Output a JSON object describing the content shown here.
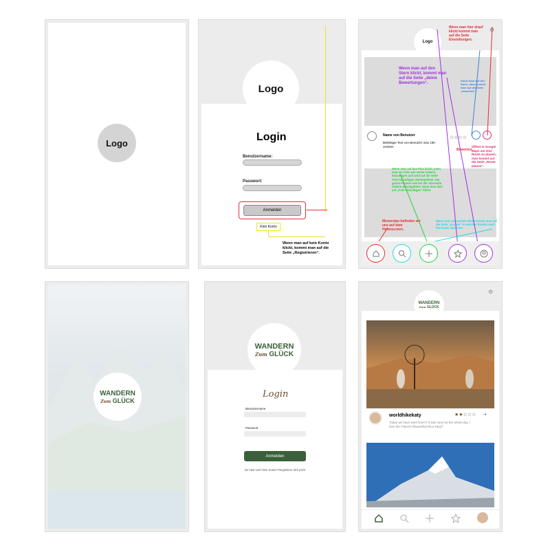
{
  "wireframe": {
    "splash": {
      "logo_text": "Logo"
    },
    "login": {
      "logo_text": "Logo",
      "title": "Login",
      "username_label": "Benutzername:",
      "password_label": "Passwort:",
      "submit_label": "Anmelden",
      "no_account_label": "Kein Konto",
      "note_no_account": "Wenn man auf kein Konto klickt, kommt man auf die Seite „Registrieren“."
    },
    "feed": {
      "logo_text": "Logo",
      "user_name": "Name von Benutzer",
      "user_text": "Beliebiger Text von Benutzer max 150 zeichen",
      "note_settings": "Wenn man hier drauf klickt kommt man auf die Seite Einstellungen.",
      "note_star": "Wenn man auf den Stern klickt, kommt man auf die Seite „deine Bewertungen“.",
      "note_star_small": "Klickt man auf den Stern, dann kommt man auf die Seite „bewerten“.",
      "note_rate": "Bewerten",
      "note_route": "Öffnet in Google Maps um eine Route zu planen, man kommt auf die Seite „Route planen“.",
      "note_plus": "Wenn man auf das Plus klickt, kann man ein Foto aus seiner Galerie hinzufügen und wird auf die Seite Foto hinzufügen weitergeleitet. Der ganze Prozess wie bei der Startseite Galerie durchgeführt, wenn man dort auf „Foto hinzufügen“ klickt.",
      "note_home": "Momentan befinden wir uns auf dem Homescreen.",
      "note_search": "Wenn man auf Suchen klickt kommt man auf die Seite „Suchen“ in welcher Routen nach Personen oder Orte"
    }
  },
  "mockup": {
    "splash": {
      "brand_line1": "WANDERN",
      "brand_zum": "Zum",
      "brand_line2": "GLÜCK"
    },
    "login": {
      "brand_line1": "WANDERN",
      "brand_zum": "Zum",
      "brand_line2": "GLÜCK",
      "title": "Login",
      "username_label": "Benutzername",
      "password_label": "Passwort",
      "submit_label": "Anmelden",
      "register_link": "Du hast noch kein Konto? Registriere dich jetzt!"
    },
    "feed": {
      "brand_line1": "WANDERN",
      "brand_zum": "Zum",
      "brand_line2": "GLÜCK",
      "username": "worldhikekaty",
      "post_text": "Today we have seen lions?! It was very hot the whole day. I love this Place!!! #beautifulAfrica #day7",
      "rating_stars": 2,
      "rating_max": 5
    }
  },
  "colors": {
    "brand_green": "#3b5f3a",
    "annot_red": "#e8292f",
    "annot_yellow": "#f2e11b",
    "annot_purple": "#a12fe0",
    "annot_blue": "#3f7ed8",
    "annot_green": "#22d139",
    "annot_cyan": "#1fd8e0",
    "annot_pink": "#e3246e"
  }
}
